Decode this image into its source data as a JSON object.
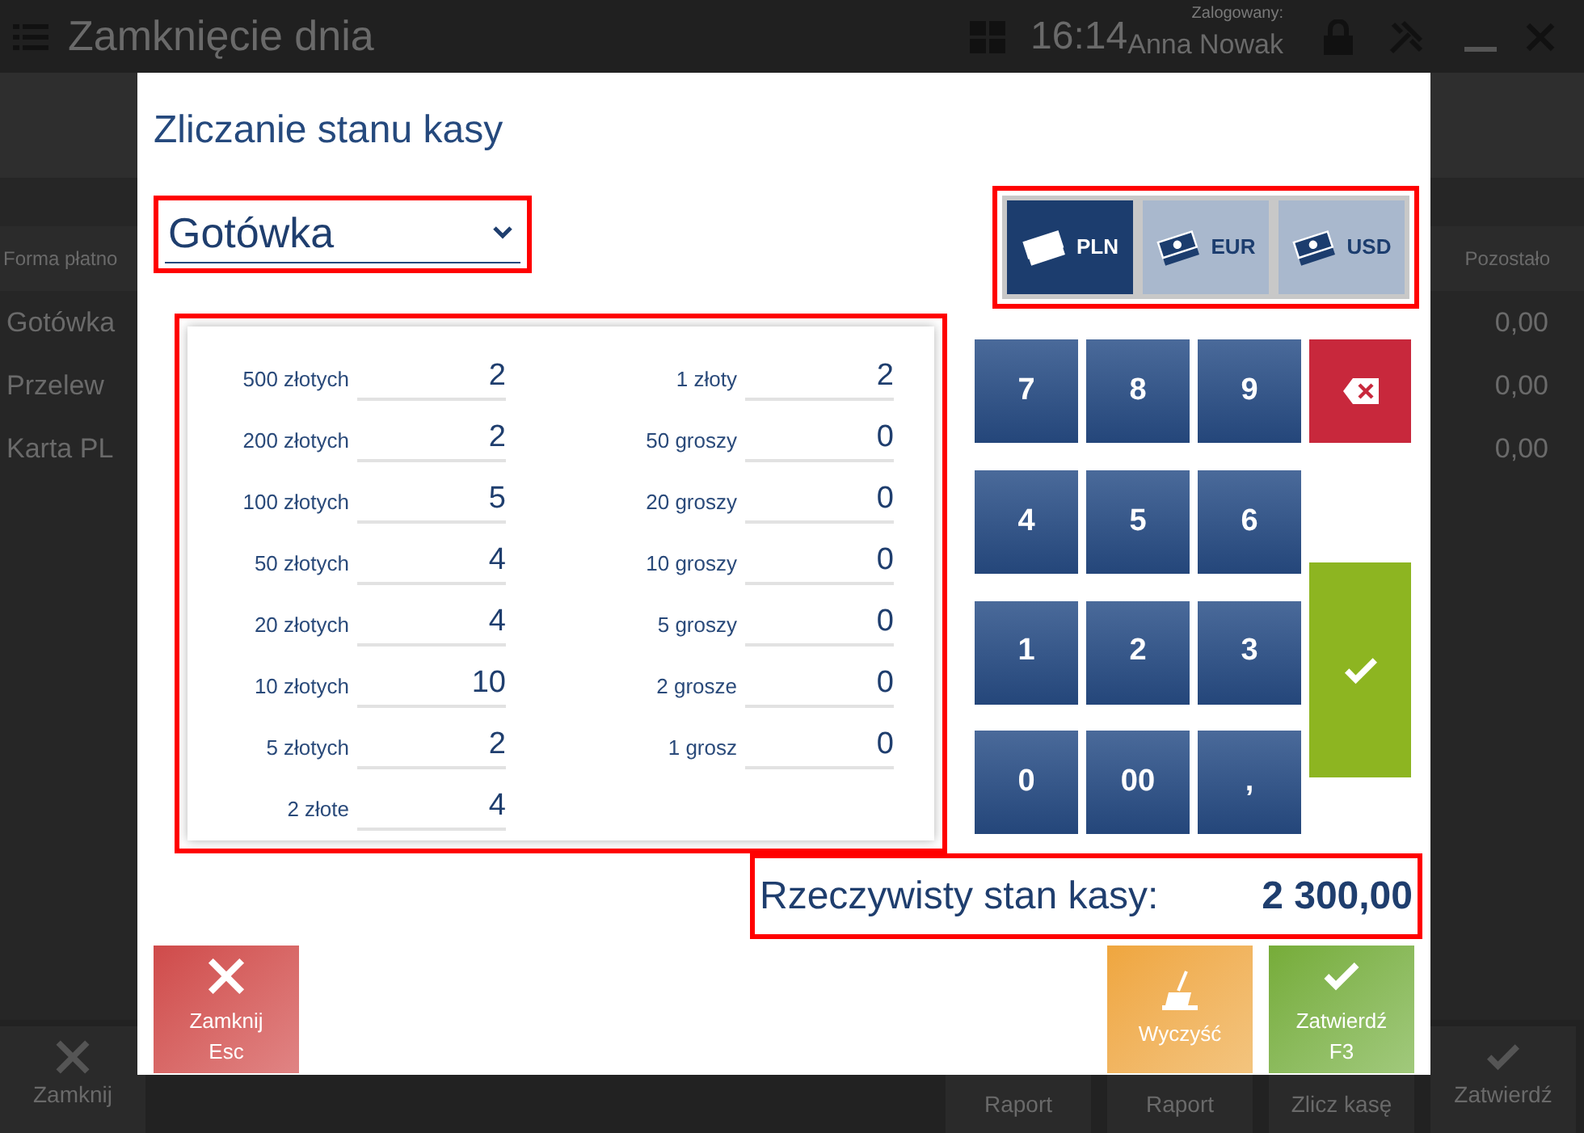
{
  "app": {
    "title": "Zamknięcie dnia",
    "time": "16:14",
    "user_label": "Zalogowany:",
    "user_name": "Anna Nowak",
    "table": {
      "columns": [
        "Forma płatno",
        "Pozostało"
      ],
      "rows": [
        {
          "method": "Gotówka",
          "remaining": "0,00"
        },
        {
          "method": "Przelew",
          "remaining": "0,00"
        },
        {
          "method": "Karta PL",
          "remaining": "0,00"
        }
      ]
    },
    "footer_buttons": [
      {
        "label": "Zamknij",
        "kind": "close"
      },
      {
        "label": "Raport",
        "kind": "text"
      },
      {
        "label": "Raport",
        "kind": "text"
      },
      {
        "label": "Zlicz kasę",
        "kind": "text"
      },
      {
        "label": "Zatwierdź",
        "kind": "confirm"
      }
    ]
  },
  "dialog": {
    "title": "Zliczanie stanu kasy",
    "payment_method": "Gotówka",
    "currencies": [
      {
        "label": "PLN",
        "selected": true
      },
      {
        "label": "EUR",
        "selected": false
      },
      {
        "label": "USD",
        "selected": false
      }
    ],
    "denominations": [
      [
        {
          "label": "500 złotych",
          "value": "2"
        },
        {
          "label": "200 złotych",
          "value": "2"
        },
        {
          "label": "100 złotych",
          "value": "5"
        },
        {
          "label": "50 złotych",
          "value": "4"
        },
        {
          "label": "20 złotych",
          "value": "4"
        },
        {
          "label": "10 złotych",
          "value": "10"
        },
        {
          "label": "5 złotych",
          "value": "2"
        },
        {
          "label": "2 złote",
          "value": "4"
        }
      ],
      [
        {
          "label": "1 złoty",
          "value": "2"
        },
        {
          "label": "50 groszy",
          "value": "0"
        },
        {
          "label": "20 groszy",
          "value": "0"
        },
        {
          "label": "10 groszy",
          "value": "0"
        },
        {
          "label": "5 groszy",
          "value": "0"
        },
        {
          "label": "2 grosze",
          "value": "0"
        },
        {
          "label": "1 grosz",
          "value": "0"
        }
      ]
    ],
    "keypad": [
      {
        "label": "7",
        "kind": "digit"
      },
      {
        "label": "8",
        "kind": "digit"
      },
      {
        "label": "9",
        "kind": "digit"
      },
      {
        "label": "4",
        "kind": "digit"
      },
      {
        "label": "5",
        "kind": "digit"
      },
      {
        "label": "6",
        "kind": "digit"
      },
      {
        "label": "1",
        "kind": "digit"
      },
      {
        "label": "2",
        "kind": "digit"
      },
      {
        "label": "3",
        "kind": "digit"
      },
      {
        "label": "0",
        "kind": "digit"
      },
      {
        "label": "00",
        "kind": "digit"
      },
      {
        "label": ",",
        "kind": "digit"
      },
      {
        "kind": "backspace"
      },
      {
        "kind": "confirm"
      }
    ],
    "total_label": "Rzeczywisty stan kasy:",
    "total_value": "2 300,00",
    "buttons": [
      {
        "label": "Zamknij",
        "sub": "Esc",
        "kind": "close"
      },
      {
        "label": "Wyczyść",
        "kind": "clear"
      },
      {
        "label": "Zatwierdź",
        "sub": "F3",
        "kind": "confirm"
      }
    ]
  }
}
